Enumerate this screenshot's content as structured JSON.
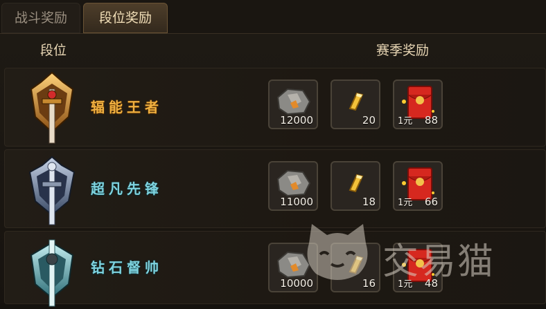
{
  "tabs": [
    {
      "label": "战斗奖励",
      "active": false
    },
    {
      "label": "段位奖励",
      "active": true
    }
  ],
  "columns": {
    "rank": "段位",
    "rewards": "赛季奖励"
  },
  "rows": [
    {
      "rank": "辐能王者",
      "badge": "gold-sword-badge-icon",
      "rewards": [
        {
          "icon": "ore-stone-icon",
          "qty": "12000"
        },
        {
          "icon": "gold-bar-icon",
          "qty": "20"
        },
        {
          "icon": "red-envelope-icon",
          "qty": "88",
          "note": "1元"
        }
      ]
    },
    {
      "rank": "超凡先锋",
      "badge": "silver-sword-badge-icon",
      "rewards": [
        {
          "icon": "ore-stone-icon",
          "qty": "11000"
        },
        {
          "icon": "gold-bar-icon",
          "qty": "18"
        },
        {
          "icon": "red-envelope-icon",
          "qty": "66",
          "note": "1元"
        }
      ]
    },
    {
      "rank": "钻石督帅",
      "badge": "teal-sword-badge-icon",
      "rewards": [
        {
          "icon": "ore-stone-icon",
          "qty": "10000"
        },
        {
          "icon": "gold-bar-icon",
          "qty": "16"
        },
        {
          "icon": "red-envelope-icon",
          "qty": "48",
          "note": "1元"
        }
      ]
    }
  ],
  "watermark": {
    "text": "交易猫",
    "icon": "cat-face-icon"
  },
  "colors": {
    "gold_rank": "#f0b040",
    "teal_rank": "#7fd3df",
    "accent_tab": "#4e3e2a"
  }
}
